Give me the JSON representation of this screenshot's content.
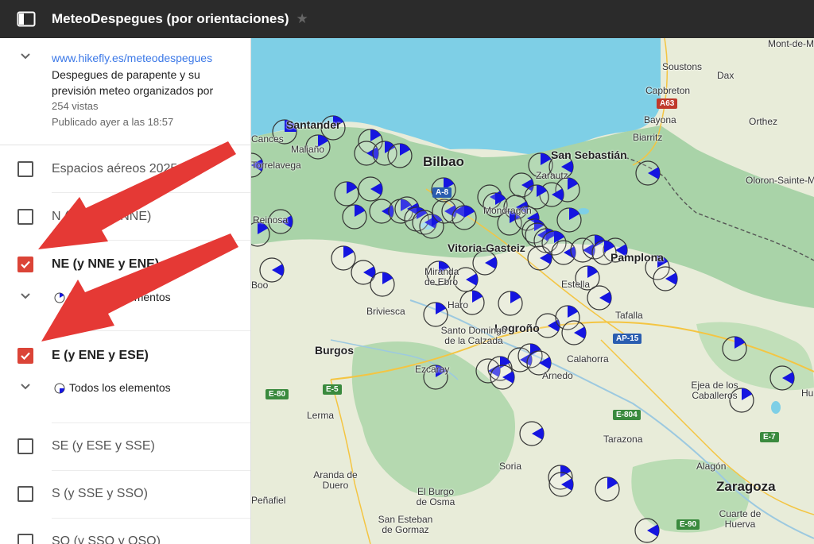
{
  "header": {
    "title": "MeteoDespegues (por orientaciones)"
  },
  "info": {
    "link": "www.hikefly.es/meteodespegues",
    "description": "Despegues de parapente y su previsión meteo organizados por",
    "views": "254 vistas",
    "published": "Publicado ayer a las 18:57"
  },
  "layers": [
    {
      "label": "Espacios aéreos 2025",
      "checked": false
    },
    {
      "label": "N (y NNO y NNE)",
      "checked": false
    },
    {
      "label": "NE (y NNE y ENE)",
      "checked": true,
      "sub": "Todos los elementos"
    },
    {
      "label": "E (y ENE y ESE)",
      "checked": true,
      "sub": "Todos los elementos"
    },
    {
      "label": "SE (y ESE y SSE)",
      "checked": false
    },
    {
      "label": "S (y SSE y SSO)",
      "checked": false
    },
    {
      "label": "SO (y SSO y OSO)",
      "checked": false
    }
  ],
  "map": {
    "places": [
      "Santander",
      "Maliaño",
      "Torrelavega",
      "Reinosa",
      "Bilbao",
      "San Sebastián",
      "Zarautz",
      "Mondragón",
      "Vitoria-Gasteiz",
      "Pamplona",
      "Miranda de Ebro",
      "Estella",
      "Haro",
      "Briviesca",
      "Logroño",
      "Santo Domingo de la Calzada",
      "Burgos",
      "Calahorra",
      "Arnedo",
      "Tafalla",
      "Ezcaray",
      "Ejea de los Caballeros",
      "Lerma",
      "Tarazona",
      "Soria",
      "Aranda de Duero",
      "El Burgo de Osma",
      "San Esteban de Gormaz",
      "Peñafiel",
      "Zaragoza",
      "Alagón",
      "Cuarte de Huerva",
      "Soustons",
      "Dax",
      "Capbreton",
      "Bayona",
      "Biarritz",
      "Orthez",
      "Oloron-Sainte-M",
      "Mont-de-M",
      "Hu",
      "Cances",
      "Boo"
    ],
    "roads": [
      "A63",
      "AP-15",
      "E-80",
      "E-5",
      "E-804",
      "E-7",
      "E-90",
      "A-8"
    ],
    "colors": {
      "sea": "#7ecfe6",
      "land": "#e8ecd9",
      "forest": "#a9d3a8",
      "pie": "#1515e0",
      "check": "#db4437",
      "arrow": "#e53935"
    }
  }
}
